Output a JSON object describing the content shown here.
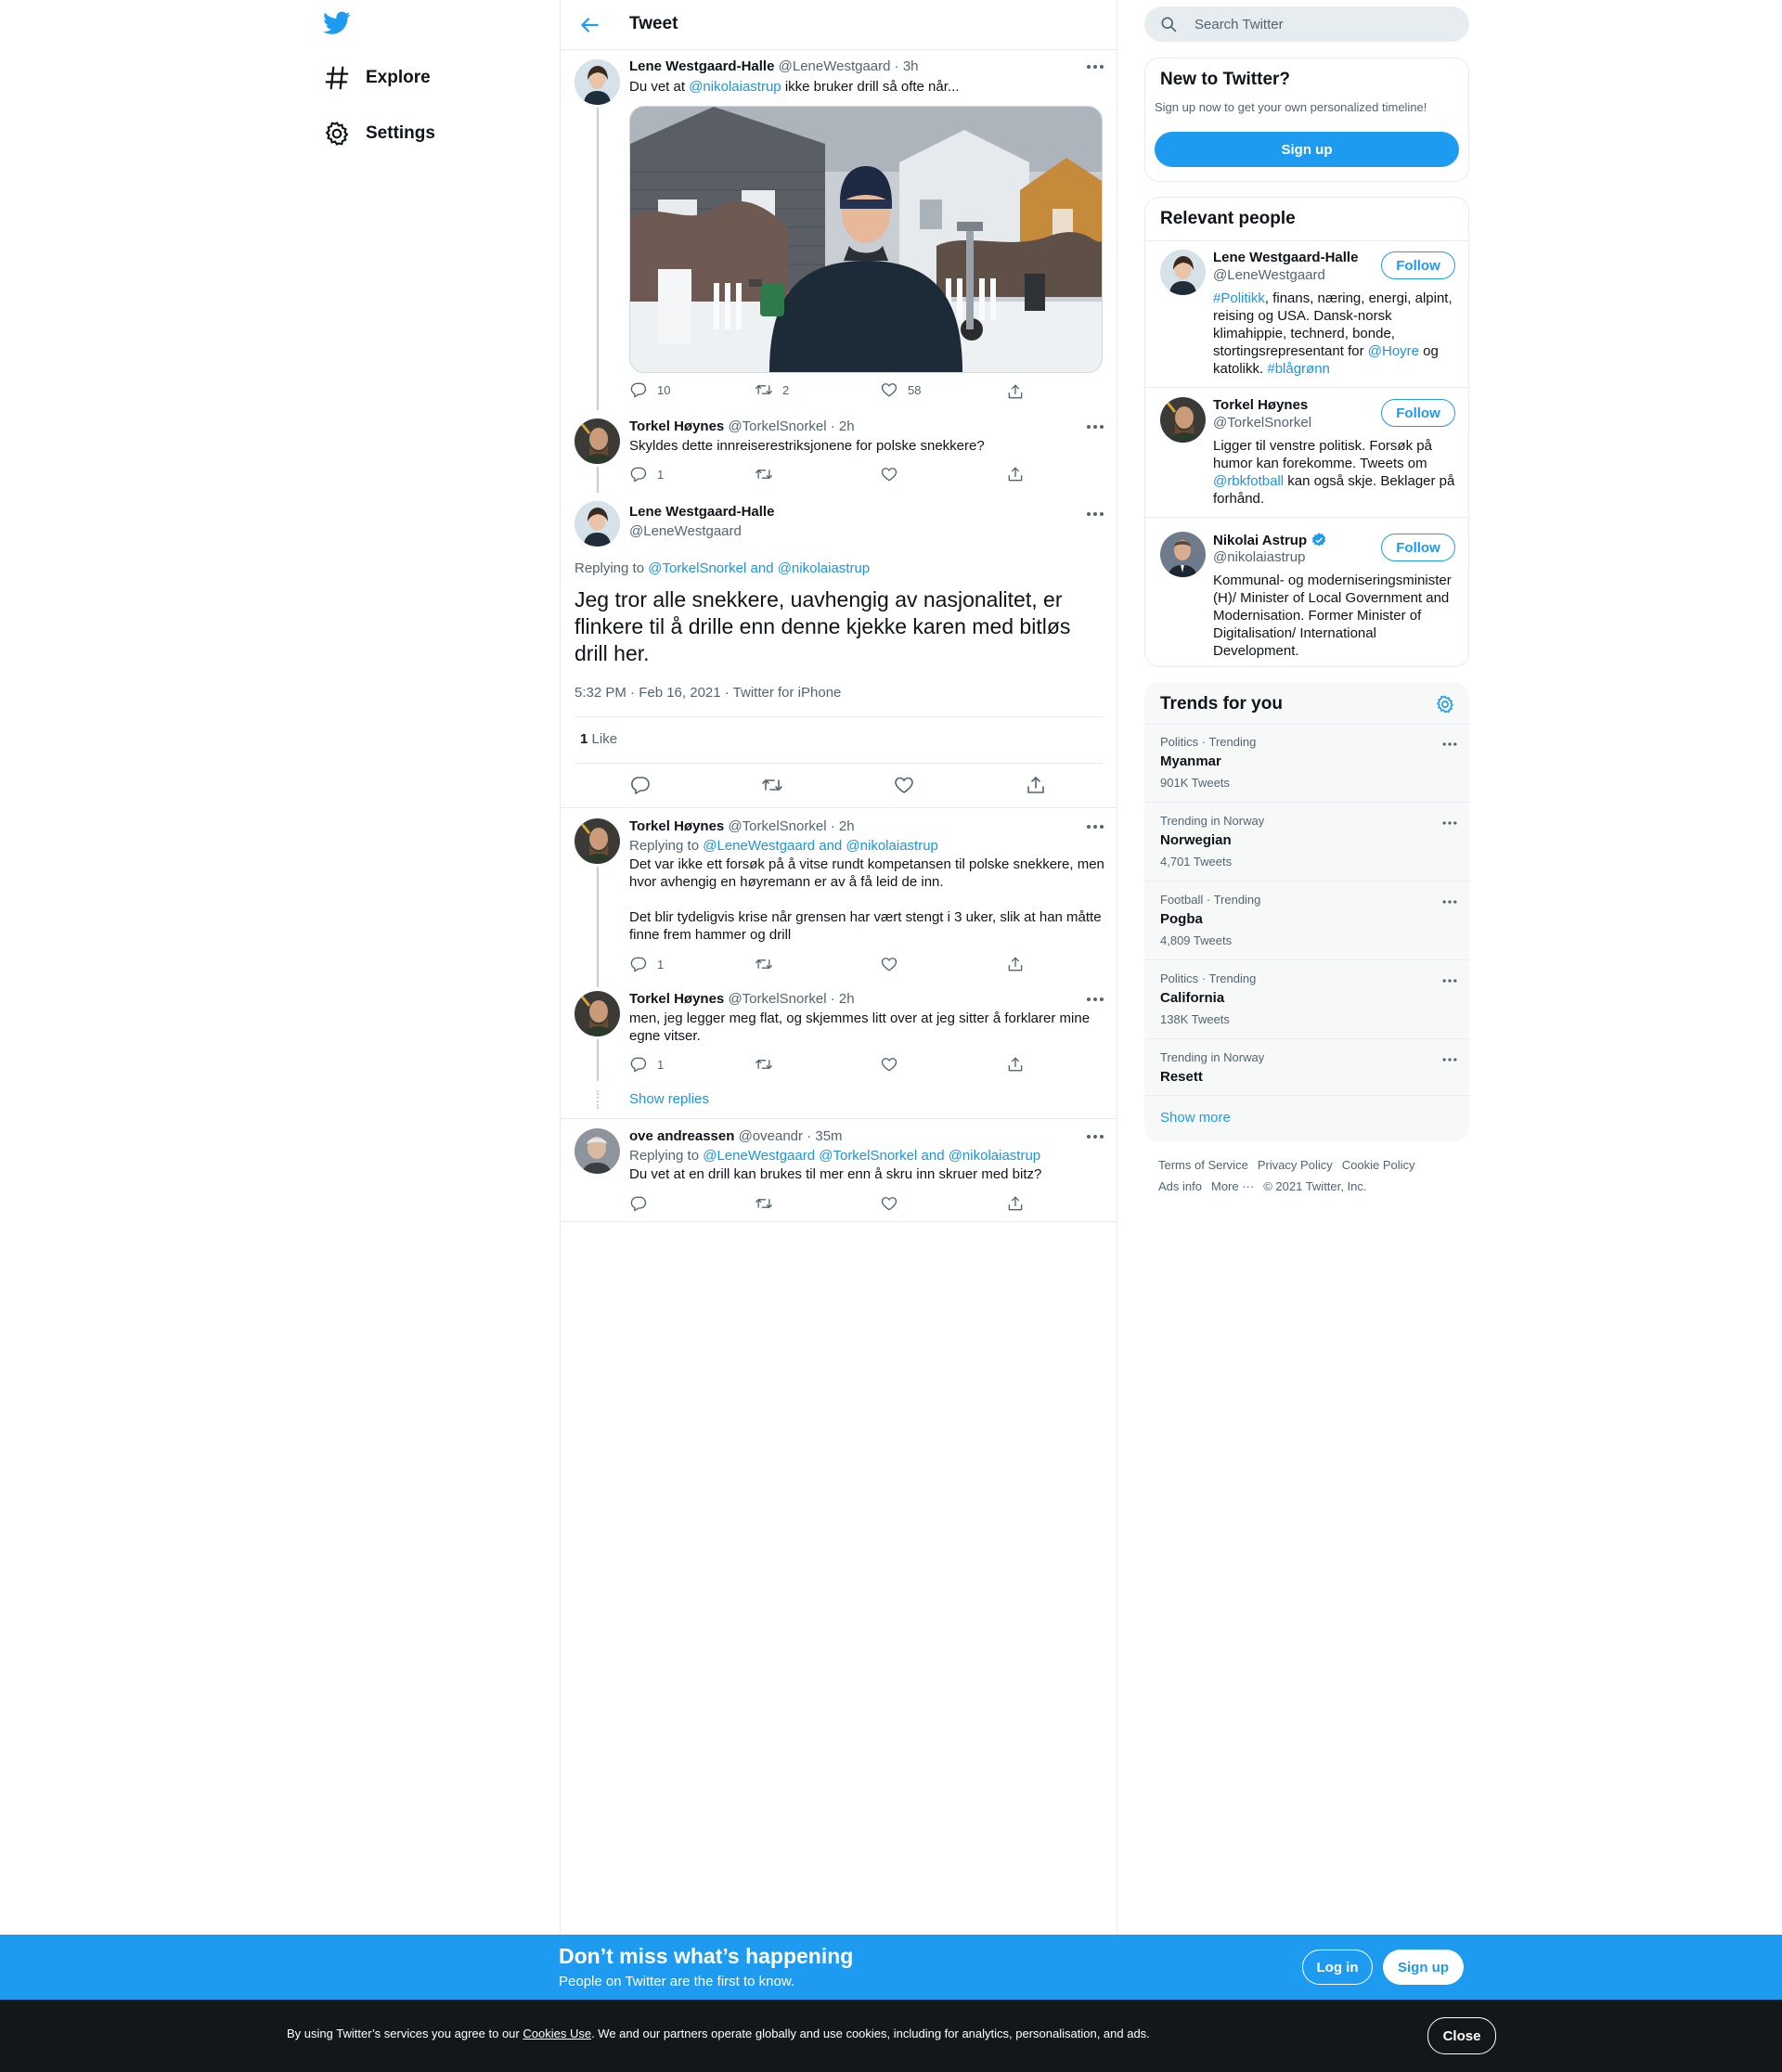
{
  "nav": {
    "explore_label": "Explore",
    "settings_label": "Settings"
  },
  "header": {
    "title": "Tweet"
  },
  "tweets": {
    "first": {
      "name": "Lene Westgaard-Halle",
      "handle": "@LeneWestgaard",
      "time": "3h",
      "text_pre": "Du vet at ",
      "mention": "@nikolaiastrup",
      "text_post": " ikke bruker drill så ofte når...",
      "replies": "10",
      "retweets": "2",
      "likes": "58"
    },
    "second": {
      "name": "Torkel Høynes",
      "handle": "@TorkelSnorkel",
      "time": "2h",
      "text": "Skyldes dette innreiserestriksjonene for polske snekkere?",
      "replies": "1"
    },
    "main": {
      "name": "Lene Westgaard-Halle",
      "handle": "@LeneWestgaard",
      "replying_to": "Replying to",
      "reply_mention_1": "@TorkelSnorkel",
      "reply_and": " and ",
      "reply_mention_2": "@nikolaiastrup",
      "text": "Jeg tror alle snekkere, uavhengig av nasjonalitet, er flinkere til å drille enn denne kjekke karen med bitløs drill her.",
      "timestamp": "5:32 PM · Feb 16, 2021",
      "source": "Twitter for iPhone",
      "like_count": "1",
      "like_label": "Like"
    },
    "reply1": {
      "name": "Torkel Høynes",
      "handle": "@TorkelSnorkel",
      "time": "2h",
      "replying_to": "Replying to",
      "mentions": "@LeneWestgaard and @nikolaiastrup",
      "para1": "Det var ikke ett forsøk på å vitse rundt kompetansen til polske snekkere, men hvor avhengig en høyremann er av å få leid de inn.",
      "para2": "Det blir tydeligvis krise når grensen har vært stengt i 3 uker, slik at han måtte finne frem hammer og drill",
      "replies": "1"
    },
    "reply2": {
      "name": "Torkel Høynes",
      "handle": "@TorkelSnorkel",
      "time": "2h",
      "text": "men, jeg legger meg flat, og skjemmes litt over at jeg sitter å forklarer mine egne vitser.",
      "replies": "1"
    },
    "show_replies": "Show replies",
    "reply3": {
      "name": "ove andreassen",
      "handle": "@oveandr",
      "time": "35m",
      "replying_to": "Replying to",
      "mentions": "@LeneWestgaard @TorkelSnorkel and @nikolaiastrup",
      "text": "Du vet at en drill kan brukes til mer enn å skru inn skruer med bitz?"
    }
  },
  "search": {
    "placeholder": "Search Twitter"
  },
  "new_to_twitter": {
    "title": "New to Twitter?",
    "subtitle": "Sign up now to get your own personalized timeline!",
    "signup": "Sign up"
  },
  "relevant": {
    "title": "Relevant people",
    "follow_label": "Follow",
    "p1": {
      "name": "Lene Westgaard-Halle",
      "handle": "@LeneWestgaard",
      "tag1": "#Politikk",
      "bio1": ", finans, næring, energi, alpint, reising og USA. Dansk-norsk klimahippie, technerd, bonde, stortingsrepresentant for ",
      "mention": "@Hoyre",
      "bio2": " og katolikk. ",
      "tag2": "#blågrønn"
    },
    "p2": {
      "name": "Torkel Høynes",
      "handle": "@TorkelSnorkel",
      "bio1": "Ligger til venstre politisk. Forsøk på humor kan forekomme. Tweets om ",
      "mention": "@rbkfotball",
      "bio2": " kan også skje. Beklager på forhånd."
    },
    "p3": {
      "name": "Nikolai Astrup",
      "handle": "@nikolaiastrup",
      "bio": "Kommunal- og moderniseringsminister (H)/ Minister of Local Government and Modernisation. Former Minister of Digitalisation/ International Development."
    }
  },
  "trends": {
    "title": "Trends for you",
    "items": [
      {
        "meta": "Politics · Trending",
        "name": "Myanmar",
        "count": "901K Tweets"
      },
      {
        "meta": "Trending in Norway",
        "name": "Norwegian",
        "count": "4,701 Tweets"
      },
      {
        "meta": "Football · Trending",
        "name": "Pogba",
        "count": "4,809 Tweets"
      },
      {
        "meta": "Politics · Trending",
        "name": "California",
        "count": "138K Tweets"
      },
      {
        "meta": "Trending in Norway",
        "name": "Resett",
        "count": ""
      }
    ],
    "show_more": "Show more"
  },
  "footer": {
    "terms": "Terms of Service",
    "privacy": "Privacy Policy",
    "cookie": "Cookie Policy",
    "ads": "Ads info",
    "more": "More ···",
    "copyright": "© 2021 Twitter, Inc."
  },
  "banner": {
    "title": "Don’t miss what’s happening",
    "subtitle": "People on Twitter are the first to know.",
    "login": "Log in",
    "signup": "Sign up"
  },
  "cookie": {
    "text_pre": "By using Twitter’s services you agree to our ",
    "link": "Cookies Use",
    "text_post": ". We and our partners operate globally and use cookies, including for analytics, personalisation, and ads.",
    "close": "Close"
  },
  "colors": {
    "accent": "#1d9bf0",
    "link": "#1b95e0",
    "text": "#0f1419",
    "secondary": "#536471",
    "border": "#e6ecf0",
    "cookie_bg": "#14171a"
  }
}
